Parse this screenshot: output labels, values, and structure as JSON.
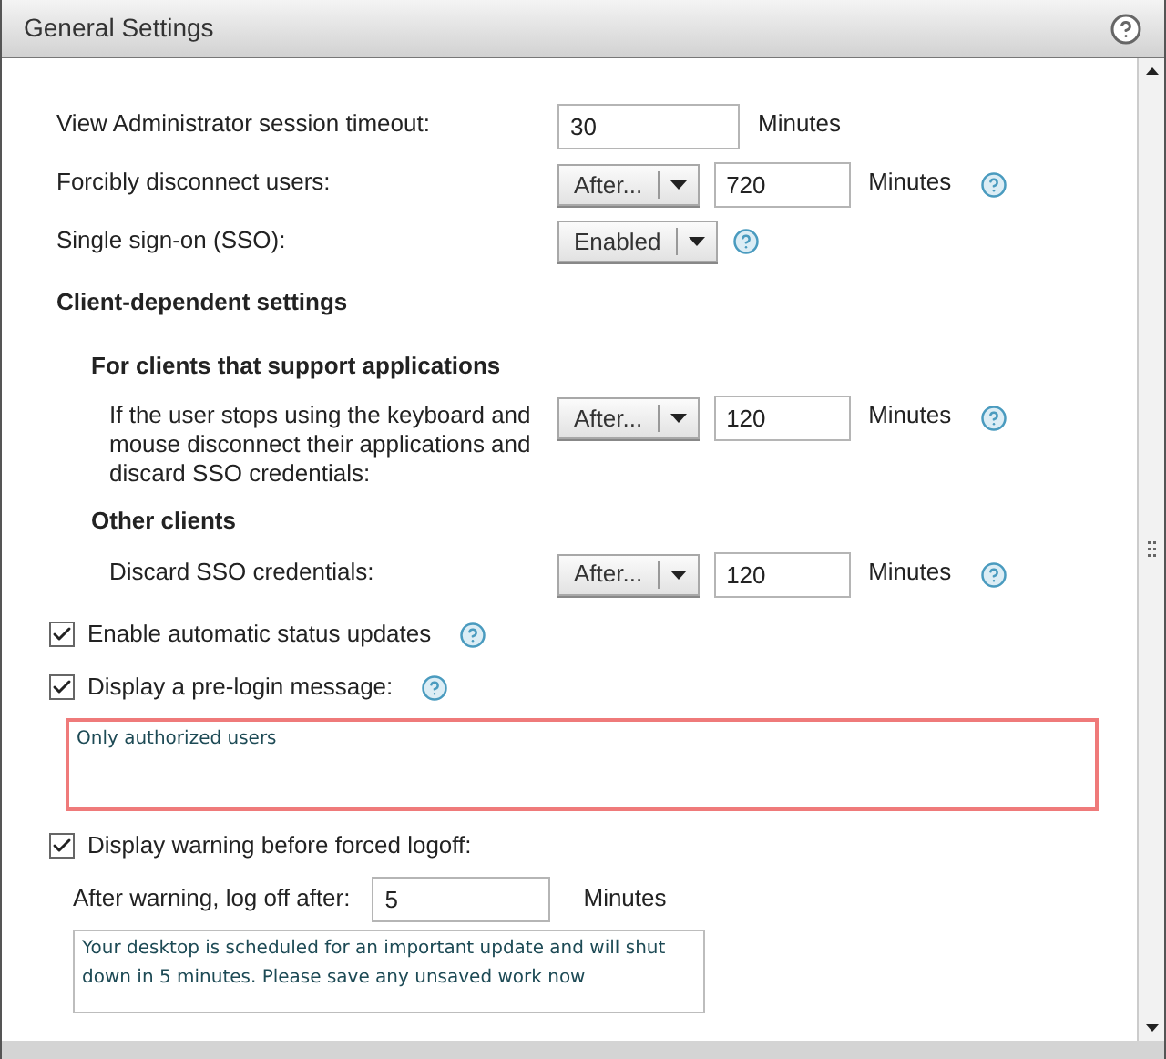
{
  "window": {
    "title": "General Settings",
    "help": true
  },
  "rows": [
    {
      "kind": "input",
      "label": "View Administrator session timeout:",
      "value": "30",
      "unit": "Minutes",
      "help": false
    },
    {
      "kind": "select-input",
      "label": "Forcibly disconnect users:",
      "select": "After...",
      "value": "720",
      "unit": "Minutes",
      "help": true
    },
    {
      "kind": "select",
      "label": "Single sign-on (SSO):",
      "select": "Enabled",
      "help": true
    }
  ],
  "client_settings": {
    "heading": "Client-dependent settings",
    "groups": [
      {
        "heading": "For clients that support applications",
        "rows": [
          {
            "kind": "select-input",
            "label": "If the user stops using the keyboard and mouse disconnect their applications and discard SSO credentials:",
            "select": "After...",
            "value": "120",
            "unit": "Minutes",
            "help": true
          }
        ]
      },
      {
        "heading": "Other clients",
        "rows": [
          {
            "kind": "select-input",
            "label": "Discard SSO credentials:",
            "select": "After...",
            "value": "120",
            "unit": "Minutes",
            "help": true
          }
        ]
      }
    ]
  },
  "options": [
    {
      "label": "Enable automatic status updates",
      "checked": true,
      "help": true
    },
    {
      "label": "Display a pre-login message:",
      "checked": true,
      "help": true,
      "message": {
        "value": "Only authorized users",
        "invalid": true
      }
    }
  ],
  "warning": {
    "label": "Display warning before forced logoff:",
    "checked": true,
    "logoff": {
      "label": "After warning, log off after:",
      "value": "5",
      "unit": "Minutes"
    },
    "message": {
      "value": "Your desktop is scheduled for an important update and will shut down in 5 minutes. Please save any unsaved work now",
      "invalid": false
    }
  }
}
